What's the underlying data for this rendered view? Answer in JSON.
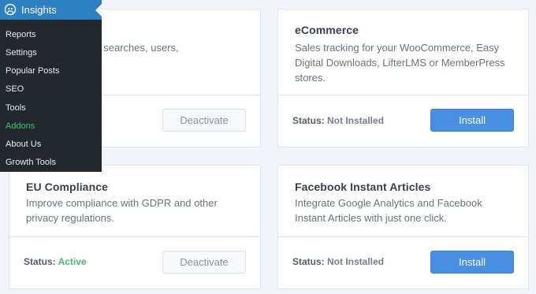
{
  "menu": {
    "title": "Insights",
    "items": [
      {
        "label": "Reports"
      },
      {
        "label": "Settings"
      },
      {
        "label": "Popular Posts"
      },
      {
        "label": "SEO"
      },
      {
        "label": "Tools"
      },
      {
        "label": "Addons",
        "current": true
      },
      {
        "label": "About Us"
      },
      {
        "label": "Growth Tools"
      }
    ]
  },
  "cards": {
    "dimensions": {
      "desc": "…tegories, tags, searches, users,",
      "button": "Deactivate"
    },
    "ecommerce": {
      "title": "eCommerce",
      "desc": "Sales tracking for your WooCommerce, Easy Digital Downloads, LifterLMS or MemberPress stores.",
      "status_label": "Status:",
      "status_value": "Not Installed",
      "button": "Install"
    },
    "eu": {
      "title": "EU Compliance",
      "desc": "Improve compliance with GDPR and other privacy regulations.",
      "status_label": "Status:",
      "status_value": "Active",
      "button": "Deactivate"
    },
    "facebook": {
      "title": "Facebook Instant Articles",
      "desc": "Integrate Google Analytics and Facebook Instant Articles with just one click.",
      "status_label": "Status:",
      "status_value": "Not Installed",
      "button": "Install"
    }
  },
  "colors": {
    "menu_bg": "#23282d",
    "menu_head": "#2c7fc1",
    "active": "#4fb57a",
    "install": "#4a90e2"
  }
}
